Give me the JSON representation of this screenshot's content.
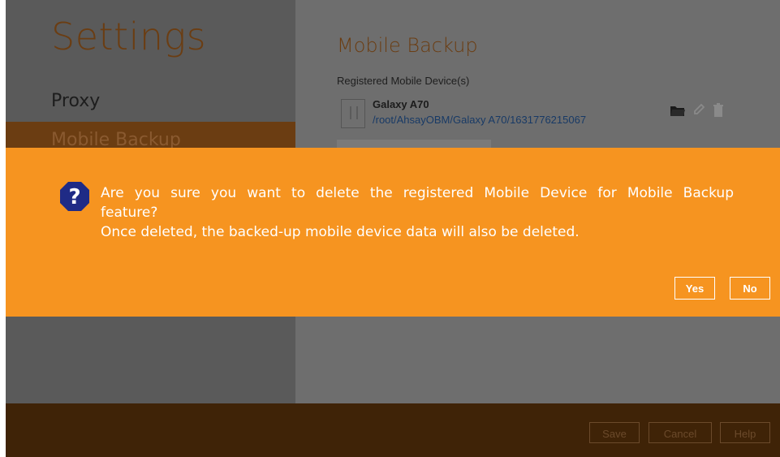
{
  "sidebar": {
    "title": "Settings",
    "items": [
      {
        "label": "Proxy"
      },
      {
        "label": "Mobile Backup"
      }
    ]
  },
  "main": {
    "title": "Mobile Backup",
    "registered_label": "Registered Mobile Device(s)",
    "device": {
      "name": "Galaxy A70",
      "path": "/root/AhsayOBM/Galaxy A70/1631776215067"
    }
  },
  "dialog": {
    "line1": "Are you sure you want to delete the registered Mobile Device for Mobile Backup",
    "line2": "feature?",
    "line3": "Once deleted, the backed-up mobile device data will also be deleted.",
    "yes_label": "Yes",
    "no_label": "No",
    "icon": "question-icon"
  },
  "footer": {
    "save_label": "Save",
    "cancel_label": "Cancel",
    "help_label": "Help"
  },
  "colors": {
    "dialog_bg": "#f69420",
    "overlay": "#6e6e6e",
    "footer_bg": "#3f2307",
    "question_icon_bg": "#1f2b86"
  }
}
